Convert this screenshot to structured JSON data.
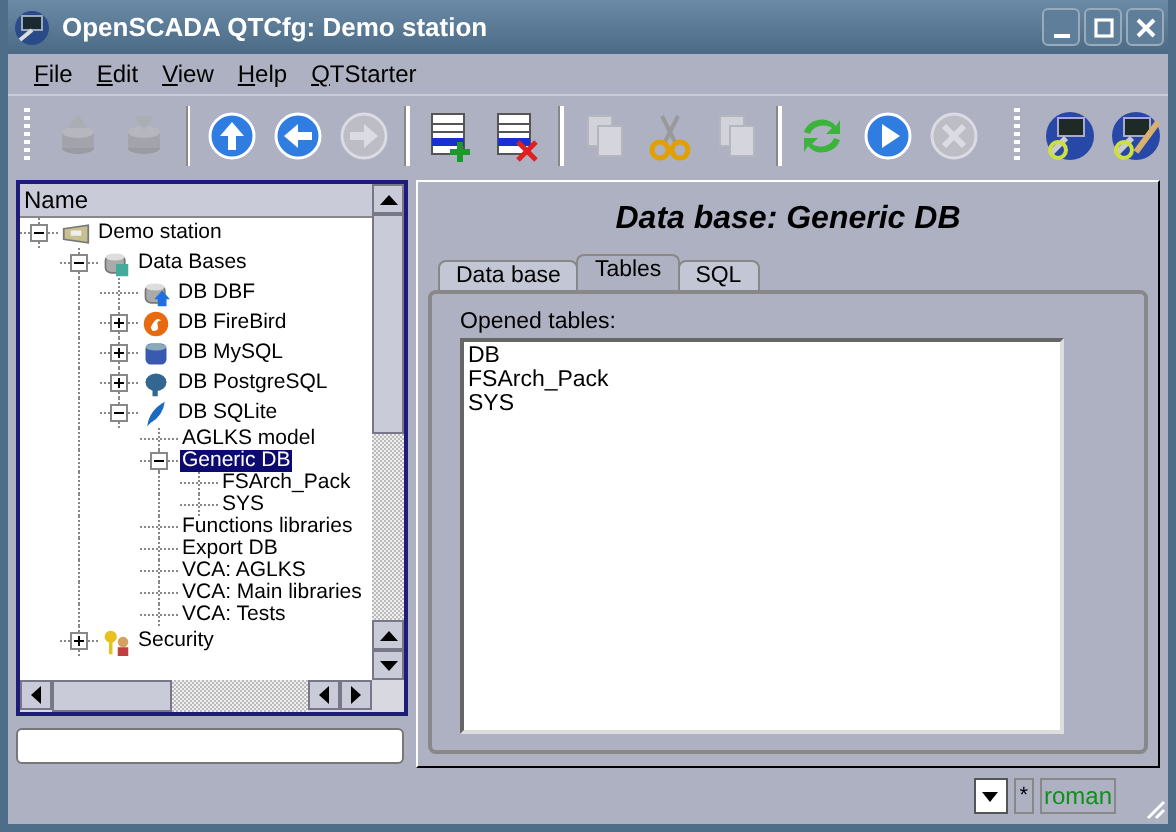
{
  "window": {
    "title": "OpenSCADA QTCfg: Demo station"
  },
  "menu": [
    {
      "label": "File"
    },
    {
      "label": "Edit"
    },
    {
      "label": "View"
    },
    {
      "label": "Help"
    },
    {
      "label": "QTStarter"
    }
  ],
  "toolbars": [
    {
      "groups": [
        [
          {
            "kind": "db-load",
            "disabled": true
          },
          {
            "kind": "db-save",
            "disabled": true
          }
        ],
        [
          {
            "kind": "up",
            "disabled": false
          },
          {
            "kind": "back",
            "disabled": false
          },
          {
            "kind": "forward",
            "disabled": true
          }
        ],
        [
          {
            "kind": "add",
            "disabled": false
          },
          {
            "kind": "delete",
            "disabled": false
          }
        ],
        [
          {
            "kind": "copy",
            "disabled": true
          },
          {
            "kind": "cut",
            "disabled": false
          },
          {
            "kind": "paste",
            "disabled": true
          }
        ],
        [
          {
            "kind": "refresh",
            "disabled": false
          },
          {
            "kind": "start",
            "disabled": false
          },
          {
            "kind": "stop",
            "disabled": true
          }
        ]
      ]
    },
    {
      "groups": [
        [
          {
            "kind": "tool",
            "disabled": false
          },
          {
            "kind": "tool-line",
            "disabled": false
          }
        ]
      ]
    }
  ],
  "tree": {
    "header": "Name",
    "items": [
      {
        "label": "Demo station",
        "kind": "station",
        "selected": false,
        "expanded": true,
        "children": [
          {
            "label": "Data Bases",
            "kind": "databases",
            "selected": false,
            "expanded": true,
            "children": [
              {
                "label": "DB DBF",
                "kind": "dbf",
                "selected": false
              },
              {
                "label": "DB FireBird",
                "kind": "firebird",
                "selected": false,
                "expanded": false
              },
              {
                "label": "DB MySQL",
                "kind": "mysql",
                "selected": false,
                "expanded": false
              },
              {
                "label": "DB PostgreSQL",
                "kind": "postgresql",
                "selected": false,
                "expanded": false
              },
              {
                "label": "DB SQLite",
                "kind": "sqlite",
                "selected": false,
                "expanded": true,
                "children": [
                  {
                    "label": "AGLKS model",
                    "kind": "item",
                    "selected": false
                  },
                  {
                    "label": "Generic DB",
                    "kind": "item",
                    "selected": true,
                    "expanded": true,
                    "children": [
                      {
                        "label": "FSArch_Pack",
                        "kind": "item",
                        "selected": false
                      },
                      {
                        "label": "SYS",
                        "kind": "item",
                        "selected": false
                      }
                    ]
                  },
                  {
                    "label": "Functions libraries",
                    "kind": "item",
                    "selected": false
                  },
                  {
                    "label": "Export DB",
                    "kind": "item",
                    "selected": false
                  },
                  {
                    "label": "VCA: AGLKS",
                    "kind": "item",
                    "selected": false
                  },
                  {
                    "label": "VCA: Main libraries",
                    "kind": "item",
                    "selected": false
                  },
                  {
                    "label": "VCA: Tests",
                    "kind": "item",
                    "selected": false
                  }
                ]
              }
            ]
          },
          {
            "label": "Security",
            "kind": "security",
            "selected": false,
            "expanded": false
          }
        ]
      }
    ]
  },
  "panel": {
    "title": "Data base: Generic DB",
    "tabs": [
      {
        "label": "Data base",
        "selected": false
      },
      {
        "label": "Tables",
        "selected": true
      },
      {
        "label": "SQL",
        "selected": false
      }
    ],
    "field_label": "Opened tables:",
    "tables": [
      "DB",
      "FSArch_Pack",
      "SYS"
    ]
  },
  "status_bar": {
    "modified": "*",
    "user": "roman"
  }
}
